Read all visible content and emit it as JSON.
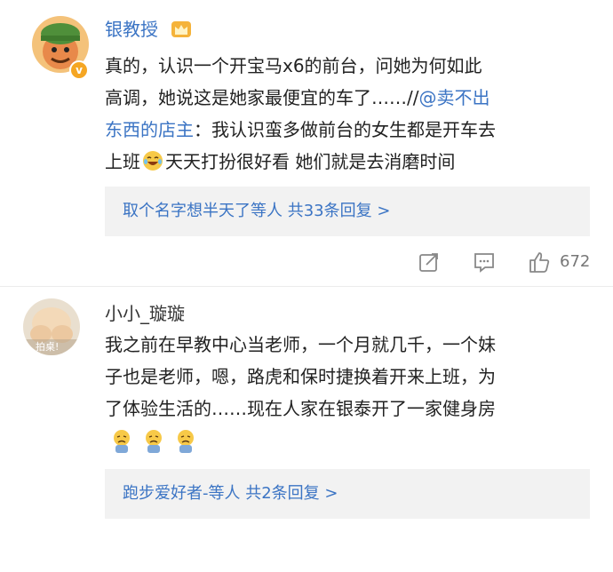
{
  "comment1": {
    "username": "银教授",
    "line1": "真的，认识一个开宝马x6的前台，问她为何如此",
    "line2_main": "高调，她说这是她家最便宜的车了……//",
    "line2_mention": "@卖不出",
    "line3_mention": "东西的店主",
    "line3_rest": "：我认识蛮多做前台的女生都是开车去",
    "line4_a": "上班",
    "line4_b": "天天打扮很好看 她们就是去消磨时间",
    "reply_summary": "取个名字想半天了等人 共33条回复 >",
    "like_count": "672"
  },
  "comment2": {
    "username": "小小_璇璇",
    "avatar_caption": "拍桌!",
    "line1": "我之前在早教中心当老师，一个月就几千，一个妹",
    "line2": "子也是老师，嗯，路虎和保时捷换着开来上班，为",
    "line3": "了体验生活的……现在人家在银泰开了一家健身房",
    "reply_summary": "跑步爱好者-等人 共2条回复 >"
  },
  "colors": {
    "link": "#3b74c4",
    "name": "#3b74c4",
    "reply_bg": "#f2f2f2",
    "action_gray": "#888888"
  },
  "icons": [
    "crown-icon",
    "verified-badge-icon",
    "laughing-crying-emoji-icon",
    "share-icon",
    "comment-icon",
    "like-icon",
    "sad-emoji-icon"
  ]
}
